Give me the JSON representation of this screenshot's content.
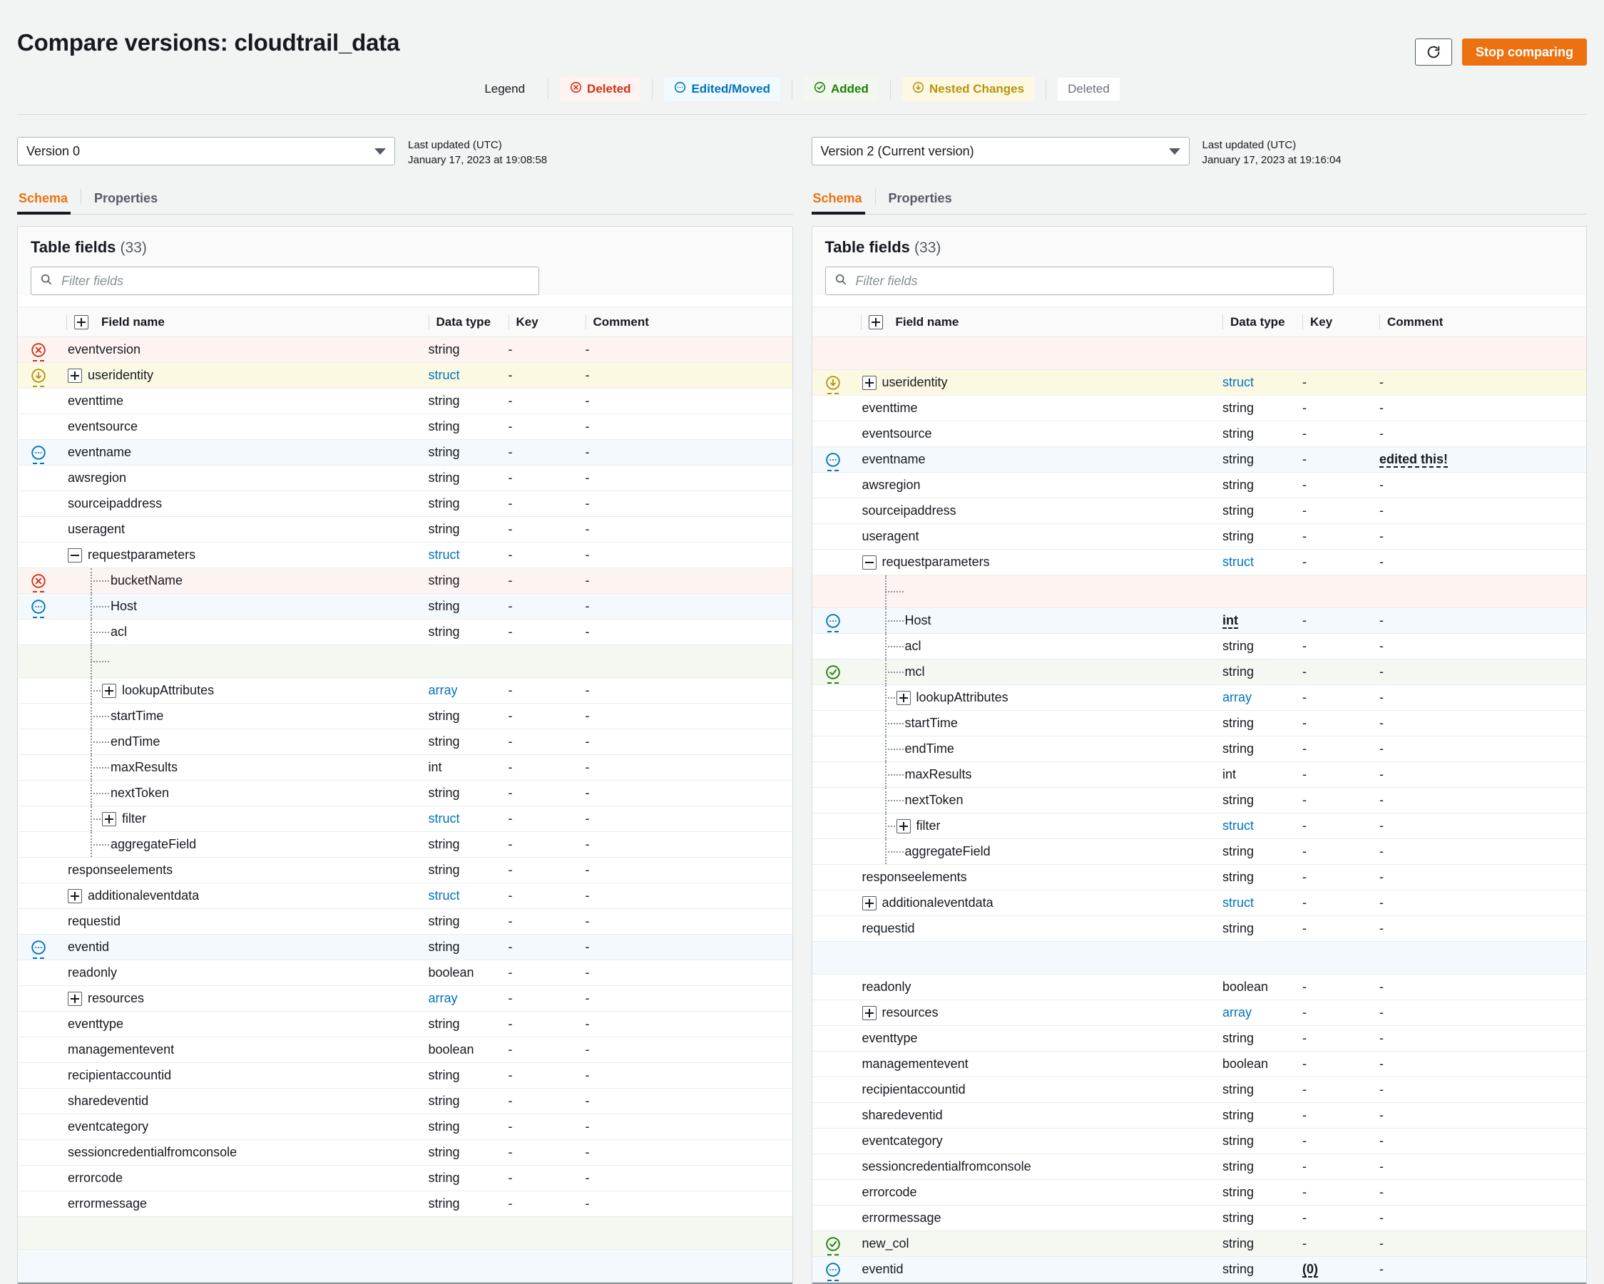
{
  "header": {
    "title": "Compare versions: cloudtrail_data",
    "refresh_icon": "refresh-icon",
    "stop_comparing_label": "Stop comparing"
  },
  "legend": {
    "label": "Legend",
    "items": [
      {
        "label": "Deleted",
        "icon": "circle-x-icon",
        "style": "deleted",
        "color": "#d13212"
      },
      {
        "label": "Edited/Moved",
        "icon": "circle-ellipsis-icon",
        "style": "edited",
        "color": "#0073bb"
      },
      {
        "label": "Added",
        "icon": "circle-check-icon",
        "style": "added",
        "color": "#1d8102"
      },
      {
        "label": "Nested Changes",
        "icon": "circle-arrow-down-icon",
        "style": "nested",
        "color": "#b7950b"
      },
      {
        "label": "Deleted",
        "icon": "none",
        "style": "plain",
        "color": "#687078"
      }
    ]
  },
  "left": {
    "version_value": "Version 0",
    "last_updated_label": "Last updated (UTC)",
    "last_updated_value": "January 17, 2023 at 19:08:58",
    "tabs": [
      {
        "label": "Schema",
        "active": true
      },
      {
        "label": "Properties",
        "active": false
      }
    ],
    "panel_title": "Table fields",
    "panel_count": "(33)",
    "filter_placeholder": "Filter fields",
    "filter_value": "",
    "columns": [
      "Field name",
      "Data type",
      "Key",
      "Comment"
    ],
    "rows": [
      {
        "status": "deleted",
        "name": "eventversion",
        "indent": 0,
        "type": "string",
        "key": "-",
        "comment": "-"
      },
      {
        "status": "nested",
        "name": "useridentity",
        "indent": 0,
        "expander": "plus",
        "type": "struct",
        "type_link": true,
        "key": "-",
        "comment": "-"
      },
      {
        "status": "",
        "name": "eventtime",
        "indent": 0,
        "type": "string",
        "key": "-",
        "comment": "-"
      },
      {
        "status": "",
        "name": "eventsource",
        "indent": 0,
        "type": "string",
        "key": "-",
        "comment": "-"
      },
      {
        "status": "edited",
        "name": "eventname",
        "indent": 0,
        "type": "string",
        "key": "-",
        "comment": "-"
      },
      {
        "status": "",
        "name": "awsregion",
        "indent": 0,
        "type": "string",
        "key": "-",
        "comment": "-"
      },
      {
        "status": "",
        "name": "sourceipaddress",
        "indent": 0,
        "type": "string",
        "key": "-",
        "comment": "-"
      },
      {
        "status": "",
        "name": "useragent",
        "indent": 0,
        "type": "string",
        "key": "-",
        "comment": "-"
      },
      {
        "status": "",
        "name": "requestparameters",
        "indent": 0,
        "expander": "minus",
        "type": "struct",
        "type_link": true,
        "key": "-",
        "comment": "-"
      },
      {
        "status": "deleted",
        "name": "bucketName",
        "indent": 1,
        "connector": true,
        "type": "string",
        "key": "-",
        "comment": "-"
      },
      {
        "status": "edited",
        "name": "Host",
        "indent": 1,
        "connector": true,
        "type": "string",
        "key": "-",
        "comment": "-"
      },
      {
        "status": "",
        "name": "acl",
        "indent": 1,
        "connector": true,
        "type": "string",
        "key": "-",
        "comment": "-"
      },
      {
        "status": "",
        "name": "",
        "indent": 1,
        "connector": true,
        "blank": true,
        "tint": "add",
        "type": "",
        "key": "",
        "comment": ""
      },
      {
        "status": "",
        "name": "lookupAttributes",
        "indent": 1,
        "connector": "short",
        "expander": "plus",
        "type": "array",
        "type_link": true,
        "key": "-",
        "comment": "-"
      },
      {
        "status": "",
        "name": "startTime",
        "indent": 1,
        "connector": true,
        "type": "string",
        "key": "-",
        "comment": "-"
      },
      {
        "status": "",
        "name": "endTime",
        "indent": 1,
        "connector": true,
        "type": "string",
        "key": "-",
        "comment": "-"
      },
      {
        "status": "",
        "name": "maxResults",
        "indent": 1,
        "connector": true,
        "type": "int",
        "key": "-",
        "comment": "-"
      },
      {
        "status": "",
        "name": "nextToken",
        "indent": 1,
        "connector": true,
        "type": "string",
        "key": "-",
        "comment": "-"
      },
      {
        "status": "",
        "name": "filter",
        "indent": 1,
        "connector": "short",
        "expander": "plus",
        "type": "struct",
        "type_link": true,
        "key": "-",
        "comment": "-"
      },
      {
        "status": "",
        "name": "aggregateField",
        "indent": 1,
        "connector": true,
        "type": "string",
        "key": "-",
        "comment": "-"
      },
      {
        "status": "",
        "name": "responseelements",
        "indent": 0,
        "type": "string",
        "key": "-",
        "comment": "-"
      },
      {
        "status": "",
        "name": "additionaleventdata",
        "indent": 0,
        "expander": "plus",
        "type": "struct",
        "type_link": true,
        "key": "-",
        "comment": "-"
      },
      {
        "status": "",
        "name": "requestid",
        "indent": 0,
        "type": "string",
        "key": "-",
        "comment": "-"
      },
      {
        "status": "edited",
        "name": "eventid",
        "indent": 0,
        "type": "string",
        "key": "-",
        "comment": "-"
      },
      {
        "status": "",
        "name": "readonly",
        "indent": 0,
        "type": "boolean",
        "key": "-",
        "comment": "-"
      },
      {
        "status": "",
        "name": "resources",
        "indent": 0,
        "expander": "plus",
        "type": "array",
        "type_link": true,
        "key": "-",
        "comment": "-"
      },
      {
        "status": "",
        "name": "eventtype",
        "indent": 0,
        "type": "string",
        "key": "-",
        "comment": "-"
      },
      {
        "status": "",
        "name": "managementevent",
        "indent": 0,
        "type": "boolean",
        "key": "-",
        "comment": "-"
      },
      {
        "status": "",
        "name": "recipientaccountid",
        "indent": 0,
        "type": "string",
        "key": "-",
        "comment": "-"
      },
      {
        "status": "",
        "name": "sharedeventid",
        "indent": 0,
        "type": "string",
        "key": "-",
        "comment": "-"
      },
      {
        "status": "",
        "name": "eventcategory",
        "indent": 0,
        "type": "string",
        "key": "-",
        "comment": "-"
      },
      {
        "status": "",
        "name": "sessioncredentialfromconsole",
        "indent": 0,
        "type": "string",
        "key": "-",
        "comment": "-"
      },
      {
        "status": "",
        "name": "errorcode",
        "indent": 0,
        "type": "string",
        "key": "-",
        "comment": "-"
      },
      {
        "status": "",
        "name": "errormessage",
        "indent": 0,
        "type": "string",
        "key": "-",
        "comment": "-"
      },
      {
        "status": "",
        "name": "",
        "indent": 0,
        "blank": true,
        "tint": "add",
        "type": "",
        "key": "",
        "comment": ""
      },
      {
        "status": "",
        "name": "",
        "indent": 0,
        "blank": true,
        "tint": "edit",
        "type": "",
        "key": "",
        "comment": ""
      }
    ]
  },
  "right": {
    "version_value": "Version 2 (Current version)",
    "last_updated_label": "Last updated (UTC)",
    "last_updated_value": "January 17, 2023 at 19:16:04",
    "tabs": [
      {
        "label": "Schema",
        "active": true
      },
      {
        "label": "Properties",
        "active": false
      }
    ],
    "panel_title": "Table fields",
    "panel_count": "(33)",
    "filter_placeholder": "Filter fields",
    "filter_value": "",
    "columns": [
      "Field name",
      "Data type",
      "Key",
      "Comment"
    ],
    "rows": [
      {
        "status": "",
        "name": "",
        "indent": 0,
        "blank": true,
        "tint": "del",
        "type": "",
        "key": "",
        "comment": ""
      },
      {
        "status": "nested",
        "name": "useridentity",
        "indent": 0,
        "expander": "plus",
        "type": "struct",
        "type_link": true,
        "key": "-",
        "comment": "-"
      },
      {
        "status": "",
        "name": "eventtime",
        "indent": 0,
        "type": "string",
        "key": "-",
        "comment": "-"
      },
      {
        "status": "",
        "name": "eventsource",
        "indent": 0,
        "type": "string",
        "key": "-",
        "comment": "-"
      },
      {
        "status": "edited",
        "name": "eventname",
        "indent": 0,
        "type": "string",
        "key": "-",
        "comment": "edited this!",
        "comment_changed": true
      },
      {
        "status": "",
        "name": "awsregion",
        "indent": 0,
        "type": "string",
        "key": "-",
        "comment": "-"
      },
      {
        "status": "",
        "name": "sourceipaddress",
        "indent": 0,
        "type": "string",
        "key": "-",
        "comment": "-"
      },
      {
        "status": "",
        "name": "useragent",
        "indent": 0,
        "type": "string",
        "key": "-",
        "comment": "-"
      },
      {
        "status": "",
        "name": "requestparameters",
        "indent": 0,
        "expander": "minus",
        "type": "struct",
        "type_link": true,
        "key": "-",
        "comment": "-"
      },
      {
        "status": "",
        "name": "",
        "indent": 1,
        "connector": true,
        "blank": true,
        "tint": "del",
        "type": "",
        "key": "",
        "comment": ""
      },
      {
        "status": "edited",
        "name": "Host",
        "indent": 1,
        "connector": true,
        "type": "int",
        "type_changed": true,
        "key": "-",
        "comment": "-"
      },
      {
        "status": "",
        "name": "acl",
        "indent": 1,
        "connector": true,
        "type": "string",
        "key": "-",
        "comment": "-"
      },
      {
        "status": "added",
        "name": "mcl",
        "indent": 1,
        "connector": true,
        "type": "string",
        "key": "-",
        "comment": "-"
      },
      {
        "status": "",
        "name": "lookupAttributes",
        "indent": 1,
        "connector": "short",
        "expander": "plus",
        "type": "array",
        "type_link": true,
        "key": "-",
        "comment": "-"
      },
      {
        "status": "",
        "name": "startTime",
        "indent": 1,
        "connector": true,
        "type": "string",
        "key": "-",
        "comment": "-"
      },
      {
        "status": "",
        "name": "endTime",
        "indent": 1,
        "connector": true,
        "type": "string",
        "key": "-",
        "comment": "-"
      },
      {
        "status": "",
        "name": "maxResults",
        "indent": 1,
        "connector": true,
        "type": "int",
        "key": "-",
        "comment": "-"
      },
      {
        "status": "",
        "name": "nextToken",
        "indent": 1,
        "connector": true,
        "type": "string",
        "key": "-",
        "comment": "-"
      },
      {
        "status": "",
        "name": "filter",
        "indent": 1,
        "connector": "short",
        "expander": "plus",
        "type": "struct",
        "type_link": true,
        "key": "-",
        "comment": "-"
      },
      {
        "status": "",
        "name": "aggregateField",
        "indent": 1,
        "connector": true,
        "type": "string",
        "key": "-",
        "comment": "-"
      },
      {
        "status": "",
        "name": "responseelements",
        "indent": 0,
        "type": "string",
        "key": "-",
        "comment": "-"
      },
      {
        "status": "",
        "name": "additionaleventdata",
        "indent": 0,
        "expander": "plus",
        "type": "struct",
        "type_link": true,
        "key": "-",
        "comment": "-"
      },
      {
        "status": "",
        "name": "requestid",
        "indent": 0,
        "type": "string",
        "key": "-",
        "comment": "-"
      },
      {
        "status": "",
        "name": "",
        "indent": 0,
        "blank": true,
        "tint": "edit",
        "type": "",
        "key": "",
        "comment": ""
      },
      {
        "status": "",
        "name": "readonly",
        "indent": 0,
        "type": "boolean",
        "key": "-",
        "comment": "-"
      },
      {
        "status": "",
        "name": "resources",
        "indent": 0,
        "expander": "plus",
        "type": "array",
        "type_link": true,
        "key": "-",
        "comment": "-"
      },
      {
        "status": "",
        "name": "eventtype",
        "indent": 0,
        "type": "string",
        "key": "-",
        "comment": "-"
      },
      {
        "status": "",
        "name": "managementevent",
        "indent": 0,
        "type": "boolean",
        "key": "-",
        "comment": "-"
      },
      {
        "status": "",
        "name": "recipientaccountid",
        "indent": 0,
        "type": "string",
        "key": "-",
        "comment": "-"
      },
      {
        "status": "",
        "name": "sharedeventid",
        "indent": 0,
        "type": "string",
        "key": "-",
        "comment": "-"
      },
      {
        "status": "",
        "name": "eventcategory",
        "indent": 0,
        "type": "string",
        "key": "-",
        "comment": "-"
      },
      {
        "status": "",
        "name": "sessioncredentialfromconsole",
        "indent": 0,
        "type": "string",
        "key": "-",
        "comment": "-"
      },
      {
        "status": "",
        "name": "errorcode",
        "indent": 0,
        "type": "string",
        "key": "-",
        "comment": "-"
      },
      {
        "status": "",
        "name": "errormessage",
        "indent": 0,
        "type": "string",
        "key": "-",
        "comment": "-"
      },
      {
        "status": "added",
        "name": "new_col",
        "indent": 0,
        "type": "string",
        "key": "-",
        "comment": "-"
      },
      {
        "status": "edited",
        "name": "eventid",
        "indent": 0,
        "type": "string",
        "key": "(0)",
        "key_changed": true,
        "comment": "-"
      }
    ]
  }
}
